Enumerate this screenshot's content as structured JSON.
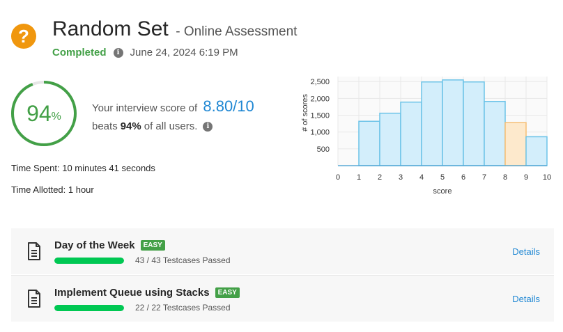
{
  "header": {
    "icon": "question-icon",
    "title": "Random Set",
    "subtitle": "- Online Assessment",
    "status": "Completed",
    "date": "June 24, 2024 6:19 PM"
  },
  "score": {
    "percent_value": "94",
    "percent_sign": "%",
    "percent_fraction": 0.94,
    "line_prefix": "Your interview score of",
    "score_text": "8.80/10",
    "beats_prefix": "beats",
    "beats_value": "94%",
    "beats_suffix": "of all users."
  },
  "time": {
    "spent": "Time Spent: 10 minutes 41 seconds",
    "allotted": "Time Allotted: 1 hour"
  },
  "chart_data": {
    "type": "bar",
    "title": "",
    "xlabel": "score",
    "ylabel": "# of scores",
    "x_ticks": [
      0,
      1,
      2,
      3,
      4,
      5,
      6,
      7,
      8,
      9,
      10
    ],
    "y_ticks": [
      "500",
      "1,000",
      "1,500",
      "2,000",
      "2,500"
    ],
    "y_tick_values": [
      500,
      1000,
      1500,
      2000,
      2500
    ],
    "ylim": [
      0,
      2650
    ],
    "xlim": [
      0,
      10
    ],
    "bins": [
      {
        "start": 1,
        "end": 2,
        "value": 1320
      },
      {
        "start": 2,
        "end": 3,
        "value": 1560
      },
      {
        "start": 3,
        "end": 4,
        "value": 1890
      },
      {
        "start": 4,
        "end": 5,
        "value": 2490
      },
      {
        "start": 5,
        "end": 6,
        "value": 2550
      },
      {
        "start": 6,
        "end": 7,
        "value": 2490
      },
      {
        "start": 7,
        "end": 8,
        "value": 1910
      },
      {
        "start": 8,
        "end": 9,
        "value": 1280,
        "highlight": true
      },
      {
        "start": 9,
        "end": 10,
        "value": 860
      }
    ],
    "bar_color": "#d3eefb",
    "bar_stroke": "#6cc3e8",
    "highlight_color": "#fde9cc",
    "highlight_stroke": "#f6be73",
    "grid": true
  },
  "questions": [
    {
      "name": "Day of the Week",
      "badge": "EASY",
      "progress": 1.0,
      "testcases": "43 / 43 Testcases Passed",
      "details": "Details"
    },
    {
      "name": "Implement Queue using Stacks",
      "badge": "EASY",
      "progress": 1.0,
      "testcases": "22 / 22 Testcases Passed",
      "details": "Details"
    }
  ],
  "colors": {
    "accent": "#1f87d3",
    "success": "#43a047",
    "progress": "#00c853",
    "warning": "#f0970e"
  }
}
